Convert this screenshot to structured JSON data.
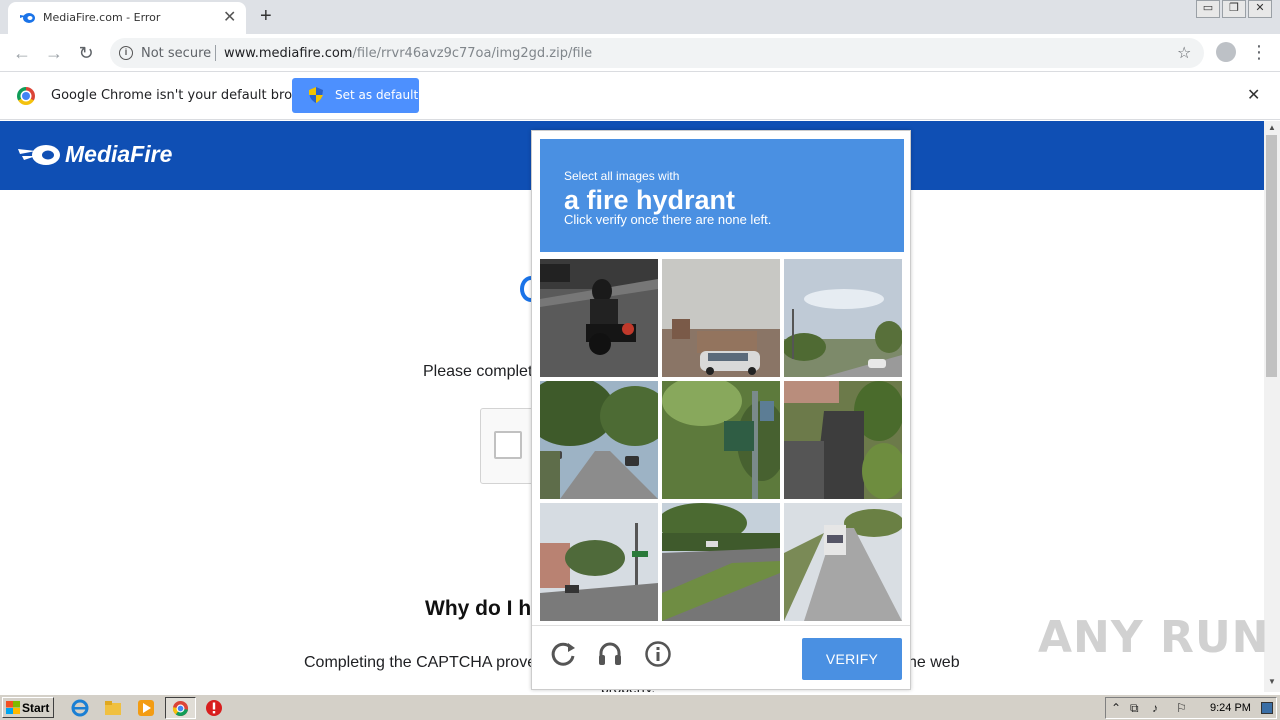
{
  "browser": {
    "tab_title": "MediaFire.com - Error",
    "new_tab_label": "+",
    "close_tab_label": "✕",
    "security_label": "Not secure",
    "url_host": "www.mediafire.com",
    "url_path": "/file/rrvr46avz9c77oa/img2gd.zip/file",
    "window_buttons": [
      "▭",
      "❐",
      "✕"
    ]
  },
  "infobar": {
    "message": "Google Chrome isn't your default browser",
    "button_label": "Set as default",
    "close_label": "✕"
  },
  "page": {
    "brand": "MediaFire",
    "please_complete": "Please complet",
    "why_heading": "Why do I h",
    "completing_text": "Completing the CAPTCHA prove",
    "the_web_text": "he web",
    "protection_text": "property."
  },
  "captcha": {
    "instruction": "Select all images with",
    "object": "a fire hydrant",
    "hint": "Click verify once there are none left.",
    "verify_label": "VERIFY",
    "icons": [
      "reload-icon",
      "audio-icon",
      "info-icon"
    ]
  },
  "watermark": "ANY RUN",
  "taskbar": {
    "start_label": "Start",
    "clock": "9:24 PM"
  },
  "colors": {
    "mediafire_blue": "#0f4fb4",
    "captcha_blue": "#4a90e2",
    "infobar_button": "#4d90fe"
  }
}
